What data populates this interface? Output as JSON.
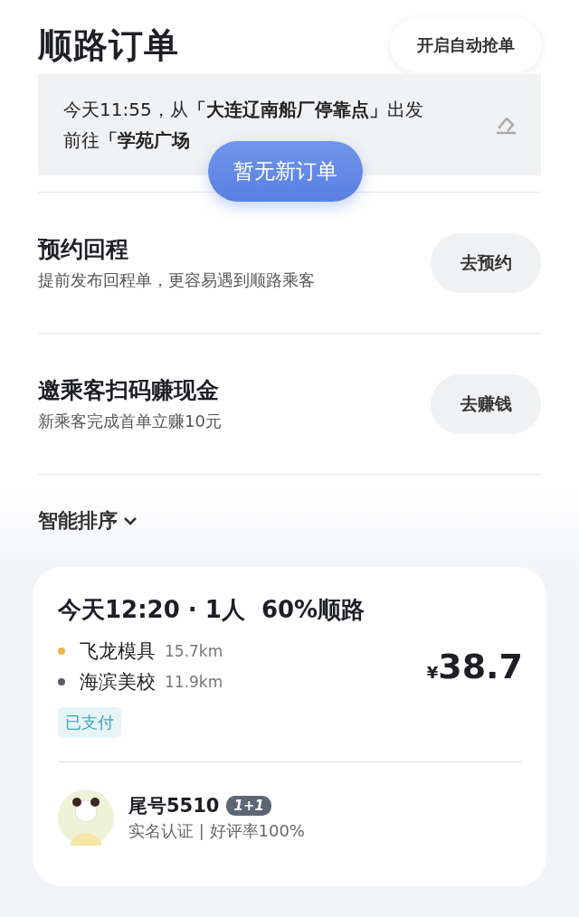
{
  "header": {
    "title": "顺路订单",
    "auto_button": "开启自动抢单"
  },
  "route": {
    "lines": [
      "今天11:55，从**「大连辽南船厂停靠点」**出发",
      "前往**「学苑广场**"
    ]
  },
  "toast": "暂无新订单",
  "actions": [
    {
      "title": "预约回程",
      "subtitle": "提前发布回程单，更容易遇到顺路乘客",
      "button": "去预约"
    },
    {
      "title": "邀乘客扫码赚现金",
      "subtitle": "新乘客完成首单立赚10元",
      "button": "去赚钱"
    }
  ],
  "sort": {
    "label": "智能排序"
  },
  "order": {
    "headline": "今天12:20 · 1人  60%顺路",
    "stops": [
      {
        "name": "飞龙模具",
        "distance": "15.7km",
        "color": "#f4b24c"
      },
      {
        "name": "海滨美校",
        "distance": "11.9km",
        "color": "#555d6a"
      }
    ],
    "currency": "¥",
    "price": "38.7",
    "status": "已支付",
    "passenger": {
      "name": "尾号5510",
      "badge": "1+1",
      "info": "实名认证 | 好评率100%"
    }
  }
}
